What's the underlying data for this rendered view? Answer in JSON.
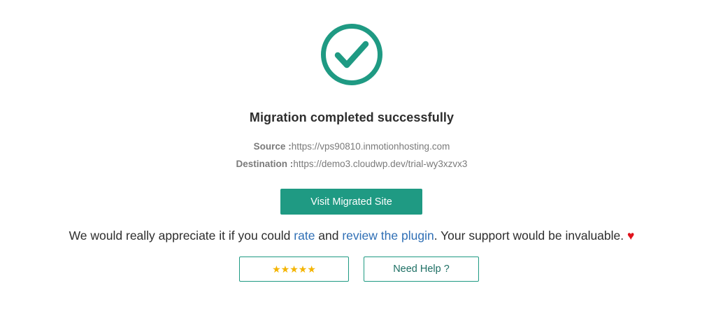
{
  "status": {
    "title": "Migration completed successfully",
    "icon": "check-circle-icon",
    "accent_color": "#1f9a83"
  },
  "details": {
    "source_label": "Source :",
    "source_value": "https://vps90810.inmotionhosting.com",
    "destination_label": "Destination :",
    "destination_value": "https://demo3.cloudwp.dev/trial-wy3xzvx3"
  },
  "actions": {
    "visit_label": "Visit Migrated Site",
    "rate_label": "★★★★★",
    "help_label": "Need Help ?"
  },
  "feedback": {
    "text_before": "We would really appreciate it if you could ",
    "rate_link": "rate",
    "text_and": " and ",
    "review_link": "review the plugin",
    "text_after": ". Your support would be invaluable. ",
    "heart": "♥"
  }
}
